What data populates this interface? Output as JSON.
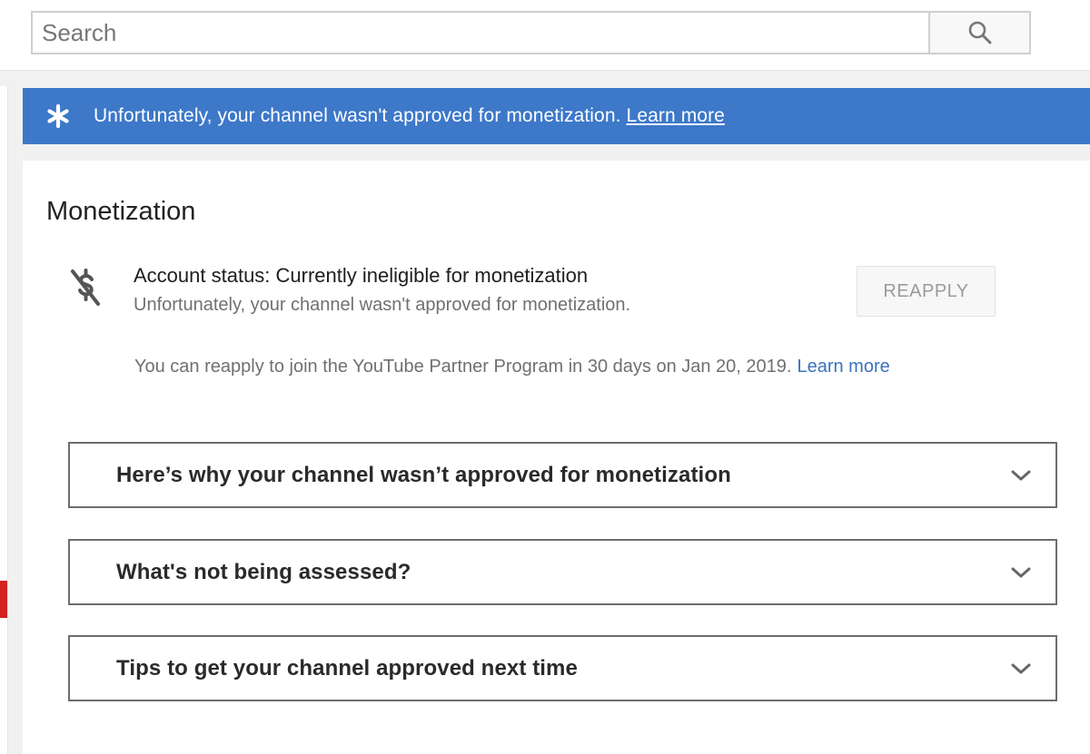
{
  "search": {
    "placeholder": "Search",
    "value": "",
    "button_icon": "search-icon"
  },
  "banner": {
    "icon": "asterisk-icon",
    "message": "Unfortunately, your channel wasn't approved for monetization.",
    "link_label": "Learn more",
    "color": "#3d78c9"
  },
  "monetization": {
    "title": "Monetization",
    "status_icon": "no-money-icon",
    "status_title": "Account status: Currently ineligible for monetization",
    "status_subtitle": "Unfortunately, your channel wasn't approved for monetization.",
    "reapply_label": "REAPPLY",
    "reapply_note": "You can reapply to join the YouTube Partner Program in 30 days on Jan 20, 2019.",
    "reapply_note_link": "Learn more",
    "link_color": "#3b72bd"
  },
  "accordions": [
    {
      "label": "Here’s why your channel wasn’t approved for monetization",
      "icon": "chevron-down-icon"
    },
    {
      "label": "What's not being assessed?",
      "icon": "chevron-down-icon"
    },
    {
      "label": "Tips to get your channel approved next time",
      "icon": "chevron-down-icon"
    }
  ],
  "sidebar_marker_color": "#d32020"
}
